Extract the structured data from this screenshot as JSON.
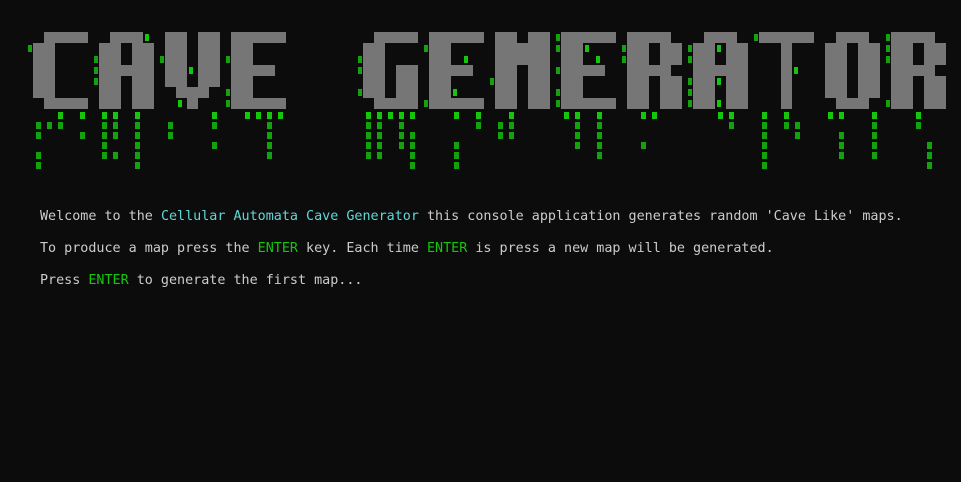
{
  "banner": {
    "title": "CAVE GENERATOR",
    "letter_color": "#767676",
    "drip_color": "#13a10e",
    "accent_color": "#16c60c"
  },
  "console": {
    "background": "#0c0c0c",
    "text_color": "#cccccc",
    "line1": {
      "prefix": "Welcome to the ",
      "highlight": "Cellular Automata Cave Generator",
      "suffix": " this console application generates random 'Cave Like' maps."
    },
    "line2": {
      "prefix": "To produce a map press the ",
      "key1": "ENTER",
      "middle": " key. Each time ",
      "key2": "ENTER",
      "suffix": " is press a new map will be generated."
    },
    "line3": {
      "prefix": "Press ",
      "key": "ENTER",
      "suffix": " to generate the first map..."
    }
  }
}
